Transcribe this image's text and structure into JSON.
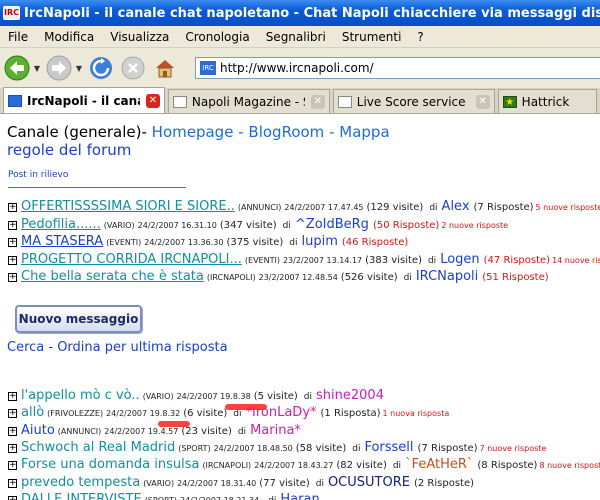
{
  "window": {
    "title": "IrcNapoli - il canale chat napoletano - Chat Napoli chiacchiere via messaggi discussioni sui forum"
  },
  "menu": [
    "File",
    "Modifica",
    "Visualizza",
    "Cronologia",
    "Segnalibri",
    "Strumenti",
    "?"
  ],
  "address_bar": {
    "url": "http://www.ircnapoli.com/"
  },
  "tabs": [
    {
      "label": "IrcNapoli - il canal...",
      "active": true
    },
    {
      "label": "Napoli Magazine - Se...",
      "active": false
    },
    {
      "label": "Live Score service (p...",
      "active": false
    },
    {
      "label": "Hattrick",
      "active": false
    }
  ],
  "page": {
    "heading_prefix": "Canale (generale)-",
    "links": [
      "Homepage",
      "BlogRoom",
      "Mappa"
    ],
    "separator": "-",
    "forum_rules": "regole del forum",
    "featured_label": "Post in rilievo",
    "new_message_button": "Nuovo messaggio",
    "search_line": "Cerca - Ordina per ultima risposta"
  },
  "featured_threads": [
    {
      "title": "OFFERTISSSSIMA SIORI E SIORE..",
      "category": "(ANNUNCI)",
      "date": "24/2/2007 17.47.45",
      "visits": "(129 visite)",
      "by": "di",
      "author": "Alex",
      "replies": "(7 Risposte)",
      "new": "5 nuove risposte",
      "title_color": "c-teal",
      "author_color": "c-blue",
      "replies_color": "c-dk"
    },
    {
      "title": "Pedofilia......",
      "category": "(VARIO)",
      "date": "24/2/2007 16.31.10",
      "visits": "(347 visite)",
      "by": "di",
      "author": "^ZoIdBeRg",
      "replies": "(50 Risposte)",
      "new": "2 nuove risposte",
      "title_color": "c-teal",
      "author_color": "c-blue",
      "replies_color": "c-red"
    },
    {
      "title": "MA STASERA",
      "category": "(EVENTI)",
      "date": "24/2/2007 13.36.30",
      "visits": "(375 visite)",
      "by": "di",
      "author": "lupim",
      "replies": "(46 Risposte)",
      "new": "",
      "title_color": "c-blue",
      "author_color": "c-blue",
      "replies_color": "c-red"
    },
    {
      "title": "PROGETTO CORRIDA IRCNAPOLI...",
      "category": "(EVENTI)",
      "date": "23/2/2007 13.14.17",
      "visits": "(383 visite)",
      "by": "di",
      "author": "Logen",
      "replies": "(47 Risposte)",
      "new": "14 nuove risposte",
      "title_color": "c-teal",
      "author_color": "c-blue",
      "replies_color": "c-red"
    },
    {
      "title": "Che bella serata che è stata",
      "category": "(IRCNAPOLI)",
      "date": "23/2/2007 12.48.54",
      "visits": "(526 visite)",
      "by": "di",
      "author": "IRCNapoli",
      "replies": "(51 Risposte)",
      "new": "",
      "title_color": "c-teal",
      "author_color": "c-blue",
      "replies_color": "c-red"
    }
  ],
  "threads": [
    {
      "title": "l'appello mò c vò..",
      "category": "(VARIO)",
      "date": "24/2/2007 19.8.38",
      "visits": "(5 visite)",
      "by": "di",
      "author": "shine2004",
      "replies": "",
      "new": "",
      "title_color": "c-teal",
      "author_color": "c-mag",
      "replies_color": "c-dk"
    },
    {
      "title": "allò",
      "category": "(FRIVOLEZZE)",
      "date": "24/2/2007 19.8.32",
      "visits": "(6 visite)",
      "by": "di",
      "author": "*IronLaDy*",
      "replies": "(1 Risposta)",
      "new": "1 nuova risposta",
      "title_color": "c-teal",
      "author_color": "c-pink",
      "replies_color": "c-dk"
    },
    {
      "title": "Aiuto",
      "category": "(ANNUNCI)",
      "date": "24/2/2007 19.4.57",
      "visits": "(23 visite)",
      "by": "di",
      "author": "Marina*",
      "replies": "",
      "new": "",
      "title_color": "c-blue",
      "author_color": "c-pink",
      "replies_color": "c-dk"
    },
    {
      "title": "Schwoch al Real Madrid",
      "category": "(SPORT)",
      "date": "24/2/2007 18.48.50",
      "visits": "(58 visite)",
      "by": "di",
      "author": "Forssell",
      "replies": "(7 Risposte)",
      "new": "7 nuove risposte",
      "title_color": "c-teal",
      "author_color": "c-blue",
      "replies_color": "c-dk"
    },
    {
      "title": "Forse una domanda insulsa",
      "category": "(IRCNAPOLI)",
      "date": "24/2/2007 18.43.27",
      "visits": "(82 visite)",
      "by": "di",
      "author": "`FeAtHeR`",
      "replies": "(8 Risposte)",
      "new": "8 nuove risposte",
      "title_color": "c-teal",
      "author_color": "c-orange",
      "replies_color": "c-dk"
    },
    {
      "title": "prevedo tempesta",
      "category": "(VARIO)",
      "date": "24/2/2007 18.31.40",
      "visits": "(77 visite)",
      "by": "di",
      "author": "OCUSUTORE",
      "replies": "(2 Risposte)",
      "new": "",
      "title_color": "c-teal",
      "author_color": "c-navy",
      "replies_color": "c-dk"
    },
    {
      "title": "DALLE INTERVISTE",
      "category": "(SPORT)",
      "date": "24/2/2007 18.21.34",
      "visits": "",
      "by": "di",
      "author": "Haran",
      "replies": "",
      "new": "",
      "title_color": "c-teal",
      "author_color": "c-blue",
      "replies_color": "c-dk"
    }
  ]
}
